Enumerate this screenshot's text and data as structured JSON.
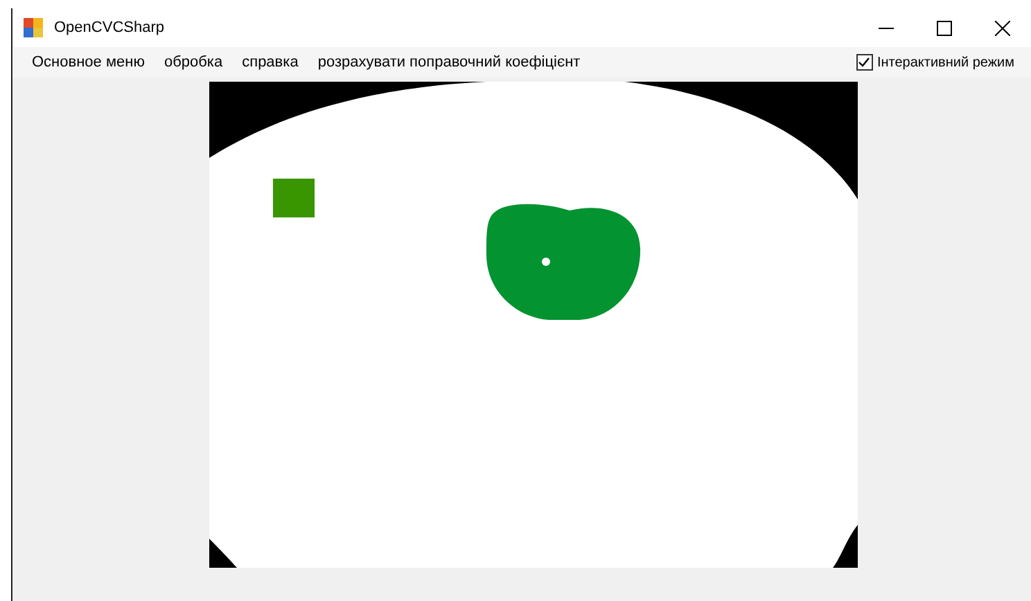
{
  "window": {
    "title": "OpenCVCSharp"
  },
  "menu": [
    {
      "label": "Основное меню"
    },
    {
      "label": "обробка"
    },
    {
      "label": "справка"
    },
    {
      "label": "розрахувати поправочний коефіцієнт"
    }
  ],
  "interactive_mode": {
    "label": "Інтерактивний режим",
    "checked": true
  }
}
